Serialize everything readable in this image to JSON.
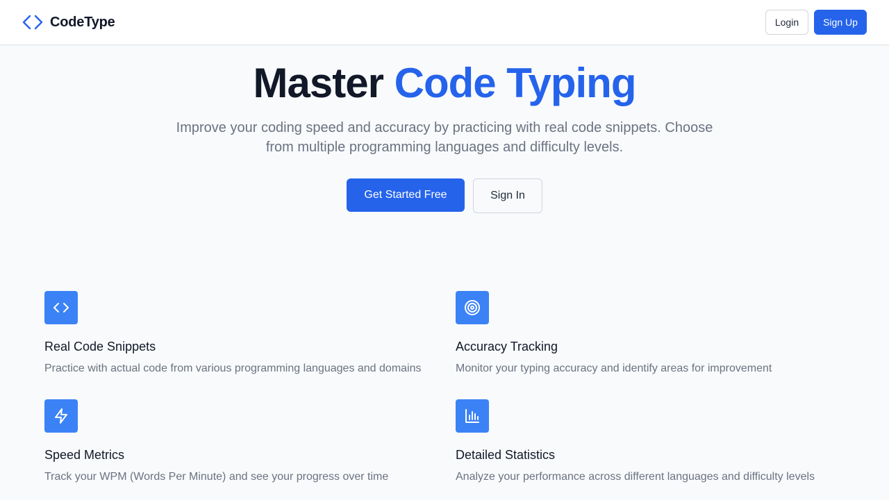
{
  "brand": {
    "name": "CodeType",
    "icon": "code-brackets-icon",
    "color": "#2563eb"
  },
  "nav": {
    "login_label": "Login",
    "signup_label": "Sign Up"
  },
  "hero": {
    "title_main": "Master",
    "title_accent": "Code Typing",
    "subtitle": "Improve your coding speed and accuracy by practicing with real code snippets. Choose from multiple programming languages and difficulty levels.",
    "primary_cta": "Get Started Free",
    "secondary_cta": "Sign In"
  },
  "features": [
    {
      "icon": "code-icon",
      "title": "Real Code Snippets",
      "description": "Practice with actual code from various programming languages and domains"
    },
    {
      "icon": "target-icon",
      "title": "Accuracy Tracking",
      "description": "Monitor your typing accuracy and identify areas for improvement"
    },
    {
      "icon": "lightning-icon",
      "title": "Speed Metrics",
      "description": "Track your WPM (Words Per Minute) and see your progress over time"
    },
    {
      "icon": "bar-chart-icon",
      "title": "Detailed Statistics",
      "description": "Analyze your performance across different languages and difficulty levels"
    }
  ],
  "colors": {
    "accent": "#2563eb",
    "feature_icon_bg": "#3b82f6",
    "background": "#f8fafc",
    "muted_text": "#6b7280"
  }
}
